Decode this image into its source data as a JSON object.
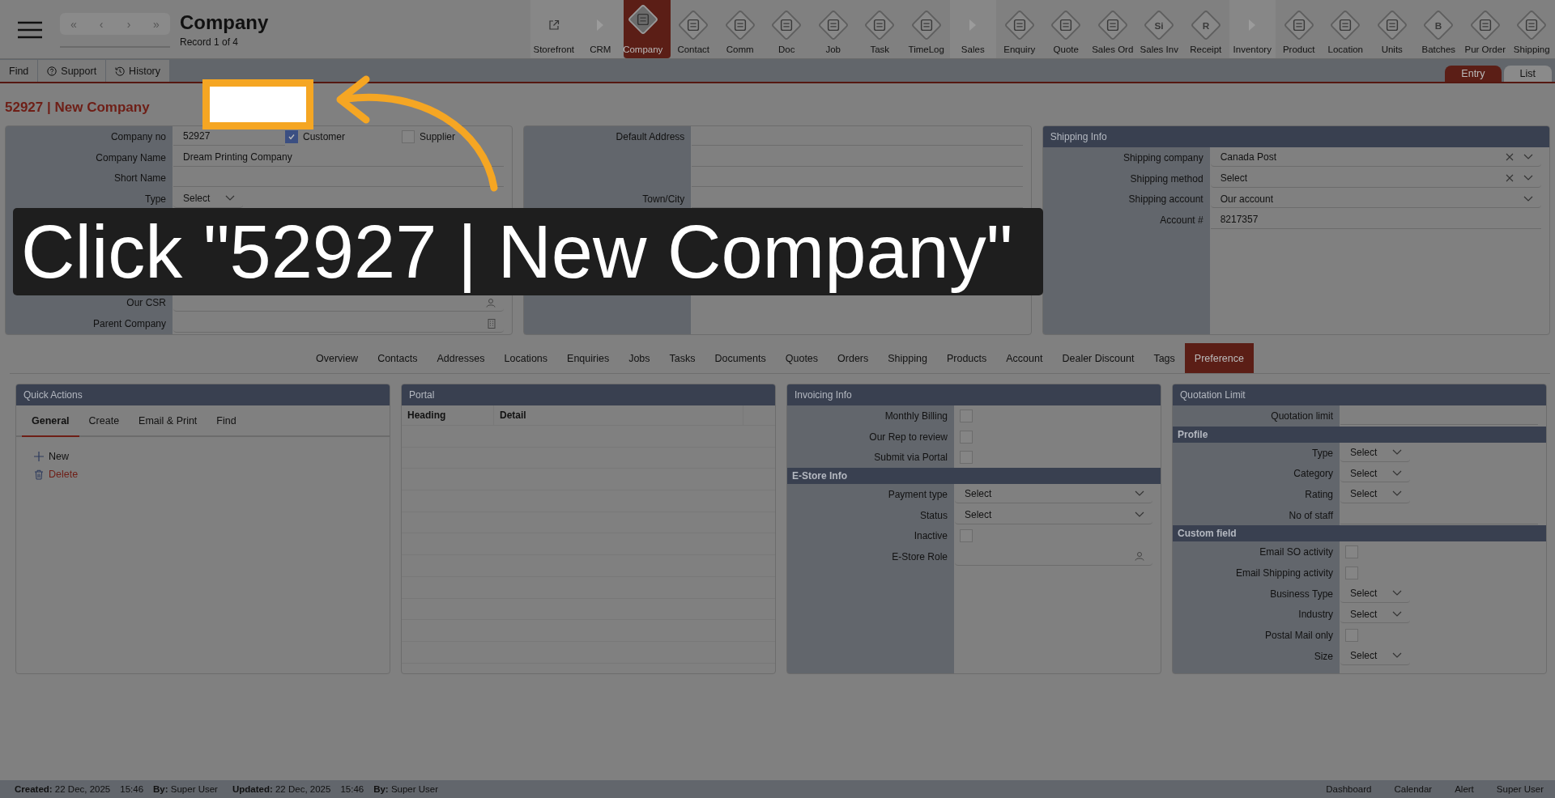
{
  "app_title": "Company",
  "record": "Record 1 of 4",
  "nav_buttons": [
    "«",
    "‹",
    "›",
    "»"
  ],
  "modules": [
    {
      "label": "Storefront",
      "kind": "link",
      "selected": false
    },
    {
      "label": "CRM",
      "kind": "group",
      "selected": false
    },
    {
      "label": "Company",
      "kind": "module",
      "selected": true
    },
    {
      "label": "Contact",
      "kind": "module",
      "selected": false
    },
    {
      "label": "Comm",
      "kind": "module",
      "selected": false
    },
    {
      "label": "Doc",
      "kind": "module",
      "selected": false
    },
    {
      "label": "Job",
      "kind": "module",
      "selected": false
    },
    {
      "label": "Task",
      "kind": "module",
      "selected": false
    },
    {
      "label": "TimeLog",
      "kind": "module",
      "selected": false
    },
    {
      "label": "Sales",
      "kind": "group",
      "selected": false
    },
    {
      "label": "Enquiry",
      "kind": "module",
      "selected": false
    },
    {
      "label": "Quote",
      "kind": "module",
      "selected": false
    },
    {
      "label": "Sales Ord",
      "kind": "module",
      "selected": false
    },
    {
      "label": "Sales Inv",
      "kind": "module",
      "selected": false,
      "glyph": "Si"
    },
    {
      "label": "Receipt",
      "kind": "module",
      "selected": false,
      "glyph": "R"
    },
    {
      "label": "Inventory",
      "kind": "group",
      "selected": false
    },
    {
      "label": "Product",
      "kind": "module",
      "selected": false
    },
    {
      "label": "Location",
      "kind": "module",
      "selected": false
    },
    {
      "label": "Units",
      "kind": "module",
      "selected": false
    },
    {
      "label": "Batches",
      "kind": "module",
      "selected": false,
      "glyph": "B"
    },
    {
      "label": "Pur Order",
      "kind": "module",
      "selected": false
    },
    {
      "label": "Shipping",
      "kind": "module",
      "selected": false
    }
  ],
  "toolbar": [
    {
      "label": "Find",
      "kind": "plain"
    },
    {
      "label": "Support",
      "kind": "help"
    },
    {
      "label": "History",
      "kind": "history"
    }
  ],
  "view_tabs": [
    {
      "label": "Entry",
      "selected": true
    },
    {
      "label": "List",
      "selected": false
    }
  ],
  "record_title": "52927 | New Company",
  "company_panel": {
    "rows": [
      {
        "label": "Company no",
        "kind": "company_no",
        "value": "52927",
        "flags": [
          {
            "label": "Customer",
            "checked": true
          },
          {
            "label": "Supplier",
            "checked": false
          }
        ]
      },
      {
        "label": "Company Name",
        "kind": "text",
        "value": "Dream Printing Company"
      },
      {
        "label": "Short Name",
        "kind": "text"
      },
      {
        "label": "Type",
        "kind": "short_select",
        "value": "Select"
      },
      {
        "kind": "text"
      },
      {
        "kind": "text"
      },
      {
        "kind": "text"
      },
      {
        "kind": "text"
      },
      {
        "label": "Our CSR",
        "kind": "lookup"
      },
      {
        "label": "Parent Company",
        "kind": "company"
      }
    ]
  },
  "address_panel": {
    "rows": [
      {
        "label": "Default Address",
        "kind": "text"
      },
      {
        "kind": "text"
      },
      {
        "kind": "text"
      },
      {
        "label": "Town/City",
        "kind": "text"
      },
      {
        "kind": "text"
      },
      {
        "kind": "text"
      },
      {
        "kind": "text"
      }
    ]
  },
  "shipping_panel": {
    "title": "Shipping Info",
    "rows": [
      {
        "label": "Shipping company",
        "kind": "select",
        "value": "Canada Post",
        "clearable": true
      },
      {
        "label": "Shipping method",
        "kind": "select",
        "value": "Select",
        "clearable": true
      },
      {
        "label": "Shipping account",
        "kind": "select",
        "value": "Our account",
        "clearable": false
      },
      {
        "label": "Account #",
        "kind": "text",
        "value": "8217357"
      }
    ]
  },
  "section_tabs": [
    {
      "label": "Overview",
      "selected": false
    },
    {
      "label": "Contacts",
      "selected": false
    },
    {
      "label": "Addresses",
      "selected": false
    },
    {
      "label": "Locations",
      "selected": false
    },
    {
      "label": "Enquiries",
      "selected": false
    },
    {
      "label": "Jobs",
      "selected": false
    },
    {
      "label": "Tasks",
      "selected": false
    },
    {
      "label": "Documents",
      "selected": false
    },
    {
      "label": "Quotes",
      "selected": false
    },
    {
      "label": "Orders",
      "selected": false
    },
    {
      "label": "Shipping",
      "selected": false
    },
    {
      "label": "Products",
      "selected": false
    },
    {
      "label": "Account",
      "selected": false
    },
    {
      "label": "Dealer Discount",
      "selected": false
    },
    {
      "label": "Tags",
      "selected": false
    },
    {
      "label": "Preference",
      "selected": true
    }
  ],
  "quick_actions": {
    "title": "Quick Actions",
    "tabs": [
      {
        "label": "General",
        "selected": true
      },
      {
        "label": "Create",
        "selected": false
      },
      {
        "label": "Email & Print",
        "selected": false
      },
      {
        "label": "Find",
        "selected": false
      }
    ],
    "actions": [
      {
        "label": "New",
        "kind": "add"
      },
      {
        "label": "Delete",
        "kind": "delete"
      }
    ]
  },
  "portal": {
    "title": "Portal",
    "columns": [
      "Heading",
      "Detail"
    ]
  },
  "invoicing_panel": {
    "title": "Invoicing Info",
    "rows": [
      {
        "label": "Monthly Billing",
        "kind": "check",
        "checked": false
      },
      {
        "label": "Our Rep to review",
        "kind": "check",
        "checked": false
      },
      {
        "label": "Submit via Portal",
        "kind": "check",
        "checked": false
      },
      {
        "section": "E-Store Info"
      },
      {
        "label": "Payment type",
        "kind": "select",
        "value": "Select",
        "clearable": false
      },
      {
        "label": "Status",
        "kind": "select",
        "value": "Select",
        "clearable": false
      },
      {
        "label": "Inactive",
        "kind": "check",
        "checked": false
      },
      {
        "label": "E-Store Role",
        "kind": "lookup"
      }
    ]
  },
  "quotation_panel": {
    "title": "Quotation Limit",
    "rows": [
      {
        "label": "Quotation limit",
        "kind": "text"
      },
      {
        "section": "Profile"
      },
      {
        "label": "Type",
        "kind": "short_select",
        "value": "Select"
      },
      {
        "label": "Category",
        "kind": "short_select",
        "value": "Select"
      },
      {
        "label": "Rating",
        "kind": "short_select",
        "value": "Select"
      },
      {
        "label": "No of staff",
        "kind": "text"
      },
      {
        "section": "Custom field"
      },
      {
        "label": "Email SO activity",
        "kind": "check",
        "checked": false
      },
      {
        "label": "Email Shipping activity",
        "kind": "check",
        "checked": false
      },
      {
        "label": "Business Type",
        "kind": "short_select",
        "value": "Select"
      },
      {
        "label": "Industry",
        "kind": "short_select",
        "value": "Select"
      },
      {
        "label": "Postal Mail only",
        "kind": "check",
        "checked": false
      },
      {
        "label": "Size",
        "kind": "short_select",
        "value": "Select"
      }
    ]
  },
  "footer": {
    "created": "**Created:** 22 Dec, 2025",
    "created_time": "15:46",
    "created_by": "**By:** Super User",
    "updated": "**Updated:** 22 Dec, 2025",
    "updated_time": "15:46",
    "updated_by": "**By:** Super User",
    "links": [
      "Dashboard",
      "Calendar",
      "Alert",
      "Super User"
    ]
  },
  "tutorial": {
    "caption": "Click \"52927 | New Company\""
  }
}
